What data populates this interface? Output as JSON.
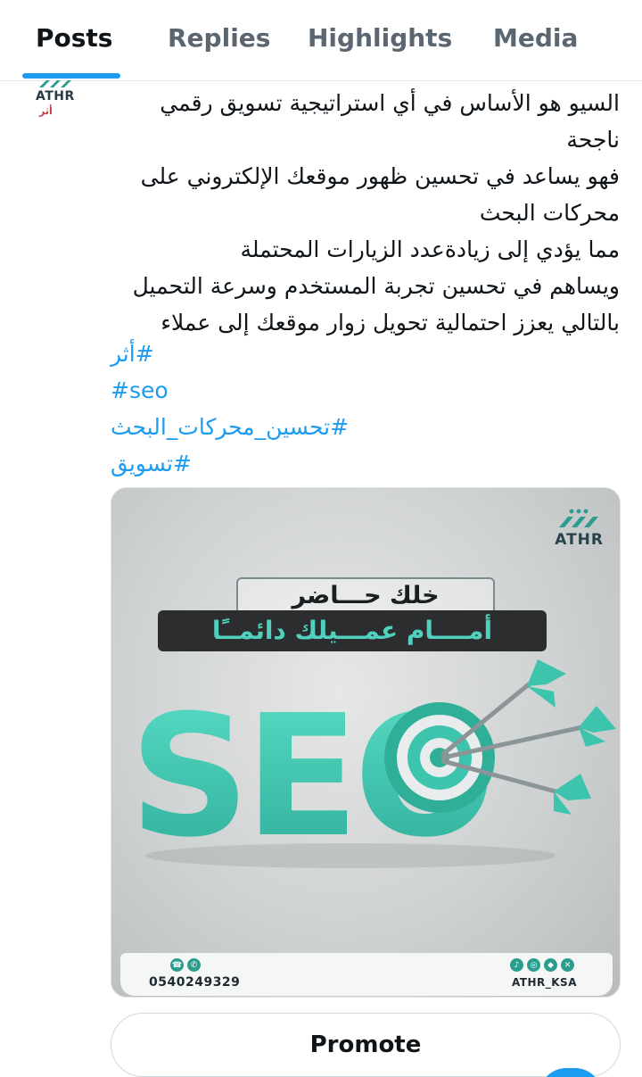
{
  "tabs": [
    {
      "label": "Posts",
      "active": true
    },
    {
      "label": "Replies",
      "active": false
    },
    {
      "label": "Highlights",
      "active": false
    },
    {
      "label": "Media",
      "active": false
    }
  ],
  "author": {
    "avatar_name": "ATHR",
    "avatar_sub": "أثر"
  },
  "post": {
    "lines": [
      "السيو هو الأساس في أي استراتيجية تسويق رقمي",
      "ناجحة",
      "فهو يساعد في تحسين ظهور موقعك الإلكتروني على",
      "محركات البحث",
      "مما يؤدي إلى زيادةعدد الزيارات المحتملة",
      "ويساهم في تحسين تجربة المستخدم وسرعة التحميل",
      "بالتالي يعزز احتمالية تحويل زوار موقعك إلى عملاء"
    ],
    "hashtags": [
      "#أثر",
      "#seo",
      "#تحسين_محركات_البحث",
      "#تسويق"
    ]
  },
  "media": {
    "brand": "ATHR",
    "headline_1": "خلك حـــاضر",
    "headline_2": "أمــــام عمـــيلك دائمــًا",
    "seo_text": "SEO",
    "phone": "0540249329",
    "handle": "ATHR_KSA",
    "accent_color": "#3cc4ad"
  },
  "actions": {
    "promote_label": "Promote"
  },
  "colors": {
    "link": "#1d9bf0",
    "text": "#0f1419",
    "muted": "#5b6670"
  }
}
